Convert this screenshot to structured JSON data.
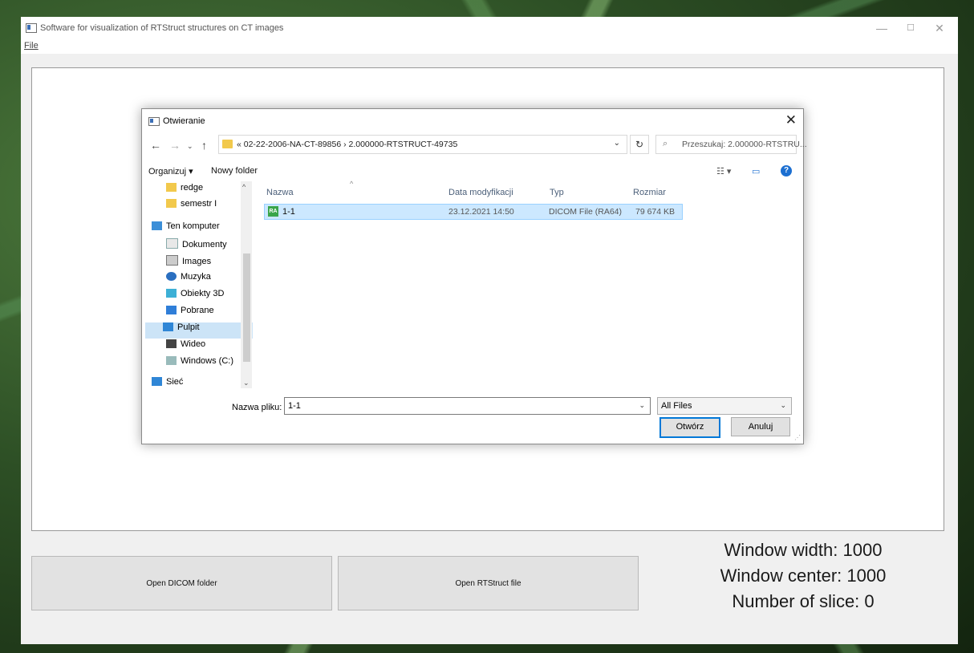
{
  "app": {
    "title": "Software for visualization of RTStruct structures on CT images",
    "menu": {
      "file": "File"
    },
    "buttons": {
      "open_dicom": "Open DICOM folder",
      "open_rtstruct": "Open RTStruct file"
    },
    "info": {
      "window_width": "Window width: 1000",
      "window_center": "Window center: 1000",
      "slice": "Number of slice: 0"
    }
  },
  "dialog": {
    "title": "Otwieranie",
    "address": "« 02-22-2006-NA-CT-89856 › 2.000000-RTSTRUCT-49735",
    "search_placeholder": "Przeszukaj: 2.000000-RTSTRU...",
    "toolbar": {
      "organize": "Organizuj ▾",
      "new_folder": "Nowy folder"
    },
    "nav": [
      {
        "label": "redge",
        "icon": "folder-icon"
      },
      {
        "label": "semestr I",
        "icon": "folder-icon"
      },
      {
        "label": "Ten komputer",
        "icon": "computer-icon"
      },
      {
        "label": "Dokumenty",
        "icon": "documents-icon"
      },
      {
        "label": "Images",
        "icon": "images-icon"
      },
      {
        "label": "Muzyka",
        "icon": "music-icon"
      },
      {
        "label": "Obiekty 3D",
        "icon": "objects-3d-icon"
      },
      {
        "label": "Pobrane",
        "icon": "downloads-icon"
      },
      {
        "label": "Pulpit",
        "icon": "desktop-icon",
        "selected": true
      },
      {
        "label": "Wideo",
        "icon": "video-icon"
      },
      {
        "label": "Windows (C:)",
        "icon": "drive-icon"
      },
      {
        "label": "Sieć",
        "icon": "network-icon"
      }
    ],
    "columns": [
      "Nazwa",
      "Data modyfikacji",
      "Typ",
      "Rozmiar"
    ],
    "files": [
      {
        "name": "1-1",
        "modified": "23.12.2021 14:50",
        "type": "DICOM File (RA64)",
        "size": "79 674 KB",
        "icon_text": "RA"
      }
    ],
    "filename_label": "Nazwa pliku:",
    "filename_value": "1-1",
    "filter": "All Files",
    "open_button": "Otwórz",
    "cancel_button": "Anuluj"
  }
}
